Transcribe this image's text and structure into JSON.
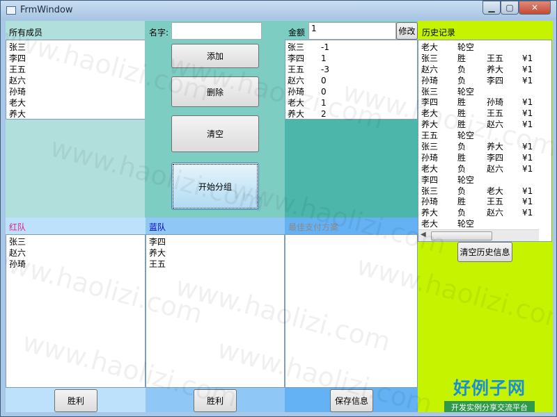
{
  "window": {
    "title": "FrmWindow",
    "min_icon": "minimize-icon",
    "max_icon": "maximize-icon",
    "close_icon": "close-icon"
  },
  "members": {
    "header": "所有成员",
    "items": [
      "张三",
      "李四",
      "王五",
      "赵六",
      "孙琦",
      "老大",
      "养大"
    ]
  },
  "name_field": {
    "label": "名字:",
    "value": ""
  },
  "buttons": {
    "add": "添加",
    "delete": "删除",
    "clear": "清空",
    "group": "开始分组"
  },
  "amount": {
    "label": "金额",
    "value": "1",
    "modify": "修改",
    "rows": [
      {
        "name": "张三",
        "value": "-1"
      },
      {
        "name": "李四",
        "value": "1"
      },
      {
        "name": "王五",
        "value": "-3"
      },
      {
        "name": "赵六",
        "value": "0"
      },
      {
        "name": "孙琦",
        "value": "0"
      },
      {
        "name": "老大",
        "value": "1"
      },
      {
        "name": "养大",
        "value": "2"
      }
    ]
  },
  "history": {
    "header": "历史记录",
    "clear_button": "清空历史信息",
    "rows": [
      [
        "老大",
        "轮空",
        "",
        ""
      ],
      [
        "张三",
        "胜",
        "王五",
        "¥1"
      ],
      [
        "赵六",
        "负",
        "养大",
        "¥1"
      ],
      [
        "孙琦",
        "负",
        "李四",
        "¥1"
      ],
      [
        "张三",
        "轮空",
        "",
        ""
      ],
      [
        "李四",
        "胜",
        "孙琦",
        "¥1"
      ],
      [
        "老大",
        "胜",
        "王五",
        "¥1"
      ],
      [
        "养大",
        "胜",
        "赵六",
        "¥1"
      ],
      [
        "王五",
        "轮空",
        "",
        ""
      ],
      [
        "张三",
        "负",
        "养大",
        "¥1"
      ],
      [
        "孙琦",
        "胜",
        "李四",
        "¥1"
      ],
      [
        "老大",
        "负",
        "赵六",
        "¥1"
      ],
      [
        "李四",
        "轮空",
        "",
        ""
      ],
      [
        "张三",
        "负",
        "老大",
        "¥1"
      ],
      [
        "孙琦",
        "胜",
        "王五",
        "¥1"
      ],
      [
        "养大",
        "负",
        "赵六",
        "¥1"
      ],
      [
        "老大",
        "轮空",
        "",
        ""
      ]
    ]
  },
  "red_team": {
    "header": "红队",
    "members": [
      "张三",
      "赵六",
      "孙琦"
    ],
    "win_button": "胜利"
  },
  "blue_team": {
    "header": "蓝队",
    "members": [
      "李四",
      "养大",
      "王五"
    ],
    "win_button": "胜利"
  },
  "best_plan": {
    "header": "最佳支付方案",
    "save_button": "保存信息"
  },
  "watermark": "www.haolizi.com",
  "logo": {
    "title": "好例子网",
    "subtitle": "开发实例分享交流平台"
  },
  "colors": {
    "members_bg": "#b1dfdc",
    "middle_bg": "#7ecdc3",
    "amount_bg": "#4db6ab",
    "red_header_bg": "#bde0fb",
    "blue_header_bg": "#8fc8f7",
    "plan_header_bg": "#64b2f4",
    "history_bg": "#c6f400",
    "red_text": "#e0208a",
    "blue_text": "#0000c8",
    "gray_text": "#8a8a8a"
  }
}
